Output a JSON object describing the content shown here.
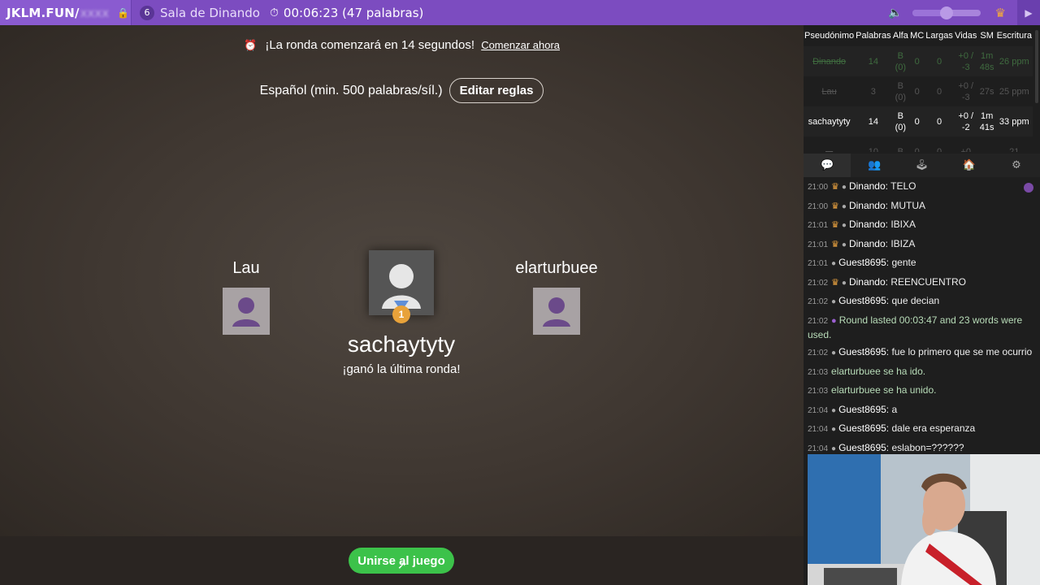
{
  "topbar": {
    "brand": "JKLM.FUN/",
    "brand_hidden": "xxxx",
    "room_count": "6",
    "room_name": "Sala de Dinando",
    "timer": "00:06:23 (47 palabras)",
    "volume_level": 0.5
  },
  "game": {
    "countdown_text": "¡La ronda comenzará en 14 segundos!",
    "start_now": "Comenzar ahora",
    "rules_text": "Español (min. 500 palabras/síl.)",
    "edit_rules": "Editar reglas",
    "left_player": "Lau",
    "right_player": "elarturbuee",
    "winner_name": "sachaytyty",
    "winner_rank": "1",
    "winner_subtitle": "¡ganó la última ronda!",
    "join_button": "Unirse al juego"
  },
  "scoreboard": {
    "headers": [
      "Pseudónimo",
      "Palabras",
      "Alfa",
      "MC",
      "Largas",
      "Vidas",
      "SM",
      "Escritura"
    ],
    "rows": [
      {
        "name": "Dinando",
        "words": "14",
        "alfa": "B (0)",
        "mc": "0",
        "largas": "0",
        "vidas": "+0 / -3",
        "sm": "1m 48s",
        "escritura": "26 ppm"
      },
      {
        "name": "Lau",
        "words": "3",
        "alfa": "B (0)",
        "mc": "0",
        "largas": "0",
        "vidas": "+0 / -3",
        "sm": "27s",
        "escritura": "25 ppm"
      },
      {
        "name": "sachaytyty",
        "words": "14",
        "alfa": "B (0)",
        "mc": "0",
        "largas": "0",
        "vidas": "+0 / -2",
        "sm": "1m 41s",
        "escritura": "33 ppm"
      },
      {
        "name": "...",
        "words": "10",
        "alfa": "B",
        "mc": "0",
        "largas": "0",
        "vidas": "+0",
        "sm": "...",
        "escritura": "21"
      }
    ]
  },
  "tabs": [
    "chat",
    "players",
    "rules",
    "room",
    "settings"
  ],
  "chat": [
    {
      "time": "21:00",
      "crown": true,
      "author": "Dinando",
      "text": "TELO"
    },
    {
      "time": "21:00",
      "crown": true,
      "author": "Dinando",
      "text": "MUTUA"
    },
    {
      "time": "21:01",
      "crown": true,
      "author": "Dinando",
      "text": "IBIXA"
    },
    {
      "time": "21:01",
      "crown": true,
      "author": "Dinando",
      "text": "IBIZA"
    },
    {
      "time": "21:01",
      "crown": false,
      "author": "Guest8695",
      "text": "gente"
    },
    {
      "time": "21:02",
      "crown": true,
      "author": "Dinando",
      "text": "REENCUENTRO"
    },
    {
      "time": "21:02",
      "crown": false,
      "author": "Guest8695",
      "text": "que decian"
    },
    {
      "time": "21:02",
      "system": true,
      "text": "Round lasted 00:03:47 and 23 words were used."
    },
    {
      "time": "21:02",
      "crown": false,
      "author": "Guest8695",
      "text": "fue lo primero que se me ocurrio"
    },
    {
      "time": "21:03",
      "system": true,
      "text": "elarturbuee se ha ido."
    },
    {
      "time": "21:03",
      "system": true,
      "text": "elarturbuee se ha unido."
    },
    {
      "time": "21:04",
      "crown": false,
      "author": "Guest8695",
      "text": "a"
    },
    {
      "time": "21:04",
      "crown": false,
      "author": "Guest8695",
      "text": "dale era esperanza"
    },
    {
      "time": "21:04",
      "crown": false,
      "author": "Guest8695",
      "text": "eslabon=??????"
    }
  ],
  "colors": {
    "topbar": "#7c4cc0",
    "join": "#3cc24a",
    "crown": "#f0a640",
    "medal": "#e8a23a"
  }
}
